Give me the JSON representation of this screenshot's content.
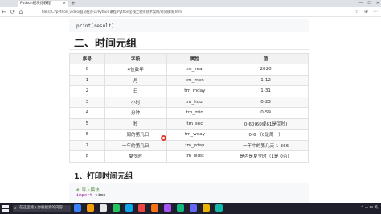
{
  "browser": {
    "tab_title": "Python模块化教程",
    "tab_close": "×",
    "new_tab": "+",
    "url": "file:///C:/python_video/自动化办公/Python课程/Python全栈工程师技术架构/时间模块.html",
    "window_minimize": "—",
    "window_maximize": "☐",
    "window_close": "✕",
    "nav_back": "←",
    "nav_refresh": "⟳",
    "nav_home": "⌂",
    "addr_icons": [
      "☆",
      "⊕",
      "⋯"
    ]
  },
  "code_block_1": {
    "text": "print(result)"
  },
  "heading_2": "二、时间元组",
  "table": {
    "headers": [
      "序号",
      "字段",
      "属性",
      "值"
    ],
    "rows": [
      [
        "0",
        "4位数年",
        "tm_year",
        "2020"
      ],
      [
        "1",
        "月",
        "tm_mon",
        "1-12"
      ],
      [
        "2",
        "日",
        "tm_mday",
        "1-31"
      ],
      [
        "3",
        "小时",
        "tm_hour",
        "0-23"
      ],
      [
        "4",
        "分钟",
        "tm_min",
        "0-59"
      ],
      [
        "5",
        "秒",
        "tm_sec",
        "0-60(60或61是闰秒)"
      ],
      [
        "6",
        "一周的第几日",
        "tm_wday",
        "0-6 （0是周一）"
      ],
      [
        "7",
        "一年的第几日",
        "tm_yday",
        "一年中的第几天 1-366"
      ],
      [
        "8",
        "夏令时",
        "tm_isdst",
        "是否是夏令时（1是 0否）"
      ]
    ]
  },
  "heading_3": "1、打印时间元组",
  "code_block_2": {
    "line1": "# 导入模块",
    "line2_kw": "import",
    "line2_rest": " time"
  },
  "taskbar": {
    "search_placeholder": "在这里输入你要搜索的内容",
    "search_icon": "⌕",
    "tray_text": "^ ▭ 中 英",
    "app_colors": [
      "#3b82f6",
      "#f59e0b",
      "#e5e7eb",
      "#22c55e",
      "#0ea5e9",
      "#ef4444",
      "#f97316",
      "#a855f7",
      "#10b981",
      "#6366f1",
      "#eab308",
      "#14b8a6"
    ]
  },
  "colors": {
    "accent_red": "#e53935",
    "table_header_bg": "#f2f2f2",
    "taskbar_bg": "#1f1f2b"
  }
}
